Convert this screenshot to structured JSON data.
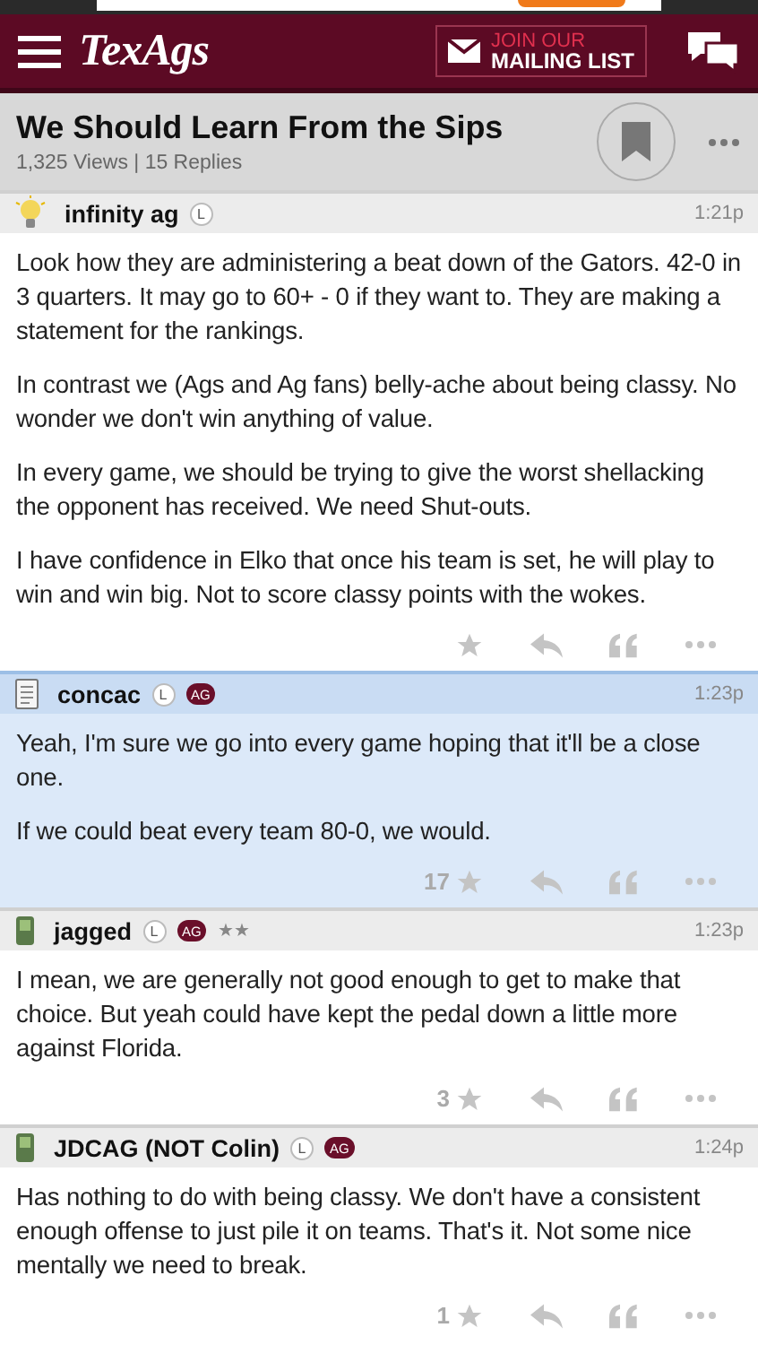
{
  "header": {
    "logo": "TexAgs",
    "mailing": {
      "line1": "JOIN OUR",
      "line2": "MAILING LIST"
    }
  },
  "thread": {
    "title": "We Should Learn From the Sips",
    "meta": "1,325 Views | 15 Replies",
    "bookmarked": false
  },
  "posts": [
    {
      "author": "infinity ag",
      "kind": "bulb",
      "badges": [
        {
          "kind": "letter",
          "text": "L"
        }
      ],
      "time": "1:21p",
      "highlighted": false,
      "paragraphs": [
        "Look how they are administering a beat down of the Gators. 42-0 in 3 quarters. It may go to 60+ - 0 if they want to. They are making a statement for the rankings.",
        "In contrast we (Ags and Ag fans) belly-ache about being classy. No wonder we don't win anything of value.",
        "In every game, we should be trying to give the worst shellacking the opponent has received. We need Shut-outs.",
        "I have confidence in Elko that once his team is set, he will play to win and win big. Not to score classy points with the wokes."
      ]
    },
    {
      "author": "concac",
      "kind": "notepad",
      "badges": [
        {
          "kind": "letter",
          "text": "L"
        },
        {
          "kind": "pill",
          "text": "AG"
        }
      ],
      "time": "1:23p",
      "highlighted": true,
      "stars_count": "17",
      "paragraphs": [
        "Yeah, I'm sure we go into every game hoping that it'll be a close one.",
        "If we could beat every team 80-0, we would."
      ]
    },
    {
      "author": "jagged",
      "kind": "phone",
      "badges": [
        {
          "kind": "letter",
          "text": "L"
        },
        {
          "kind": "pill",
          "text": "AG"
        },
        {
          "kind": "rank",
          "text": "★★"
        }
      ],
      "time": "1:23p",
      "highlighted": false,
      "stars_count": "3",
      "paragraphs": [
        "I mean, we are generally not good enough to get to make that choice. But yeah could have kept the pedal down a little more against Florida."
      ]
    },
    {
      "author": "JDCAG (NOT Colin)",
      "kind": "phone",
      "badges": [
        {
          "kind": "letter",
          "text": "L"
        },
        {
          "kind": "pill",
          "text": "AG"
        }
      ],
      "time": "1:24p",
      "highlighted": false,
      "stars_count": "1",
      "paragraphs": [
        "Has nothing to do with being classy. We don't have a consistent enough offense to just pile it on teams. That's it. Not some nice mentally we need to break."
      ]
    }
  ]
}
